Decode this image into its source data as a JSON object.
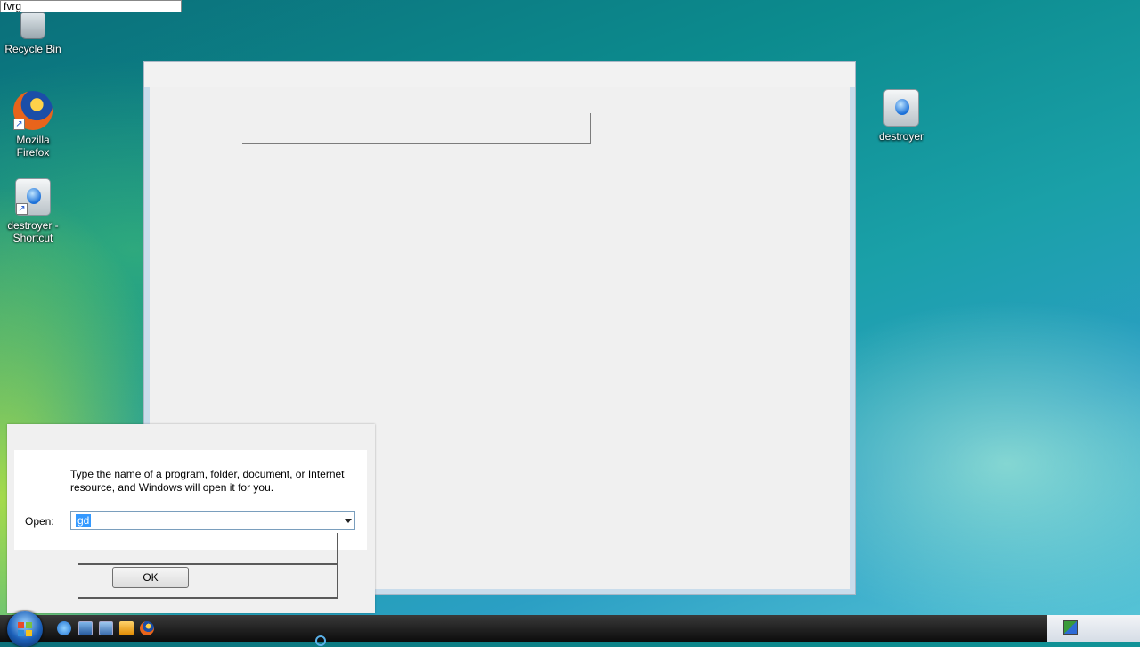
{
  "top_input": {
    "value": "fvrg"
  },
  "desktop": {
    "icons": [
      {
        "label": "Recycle Bin",
        "icon": "recycle-bin-icon"
      },
      {
        "label": "Mozilla Firefox",
        "icon": "firefox-icon"
      },
      {
        "label": "destroyer - Shortcut",
        "icon": "destroyer-app-icon"
      },
      {
        "label": "destroyer",
        "icon": "destroyer-app-icon"
      }
    ]
  },
  "run_dialog": {
    "description": "Type the name of a program, folder, document, or Internet resource, and Windows will open it for you.",
    "open_label": "Open:",
    "open_value": "gd",
    "ok_label": "OK"
  },
  "taskbar": {
    "quick_launch": [
      "internet-explorer-icon",
      "show-desktop-icon",
      "switch-windows-icon",
      "media-player-icon",
      "firefox-icon"
    ],
    "tray_icon": "network-icon"
  }
}
